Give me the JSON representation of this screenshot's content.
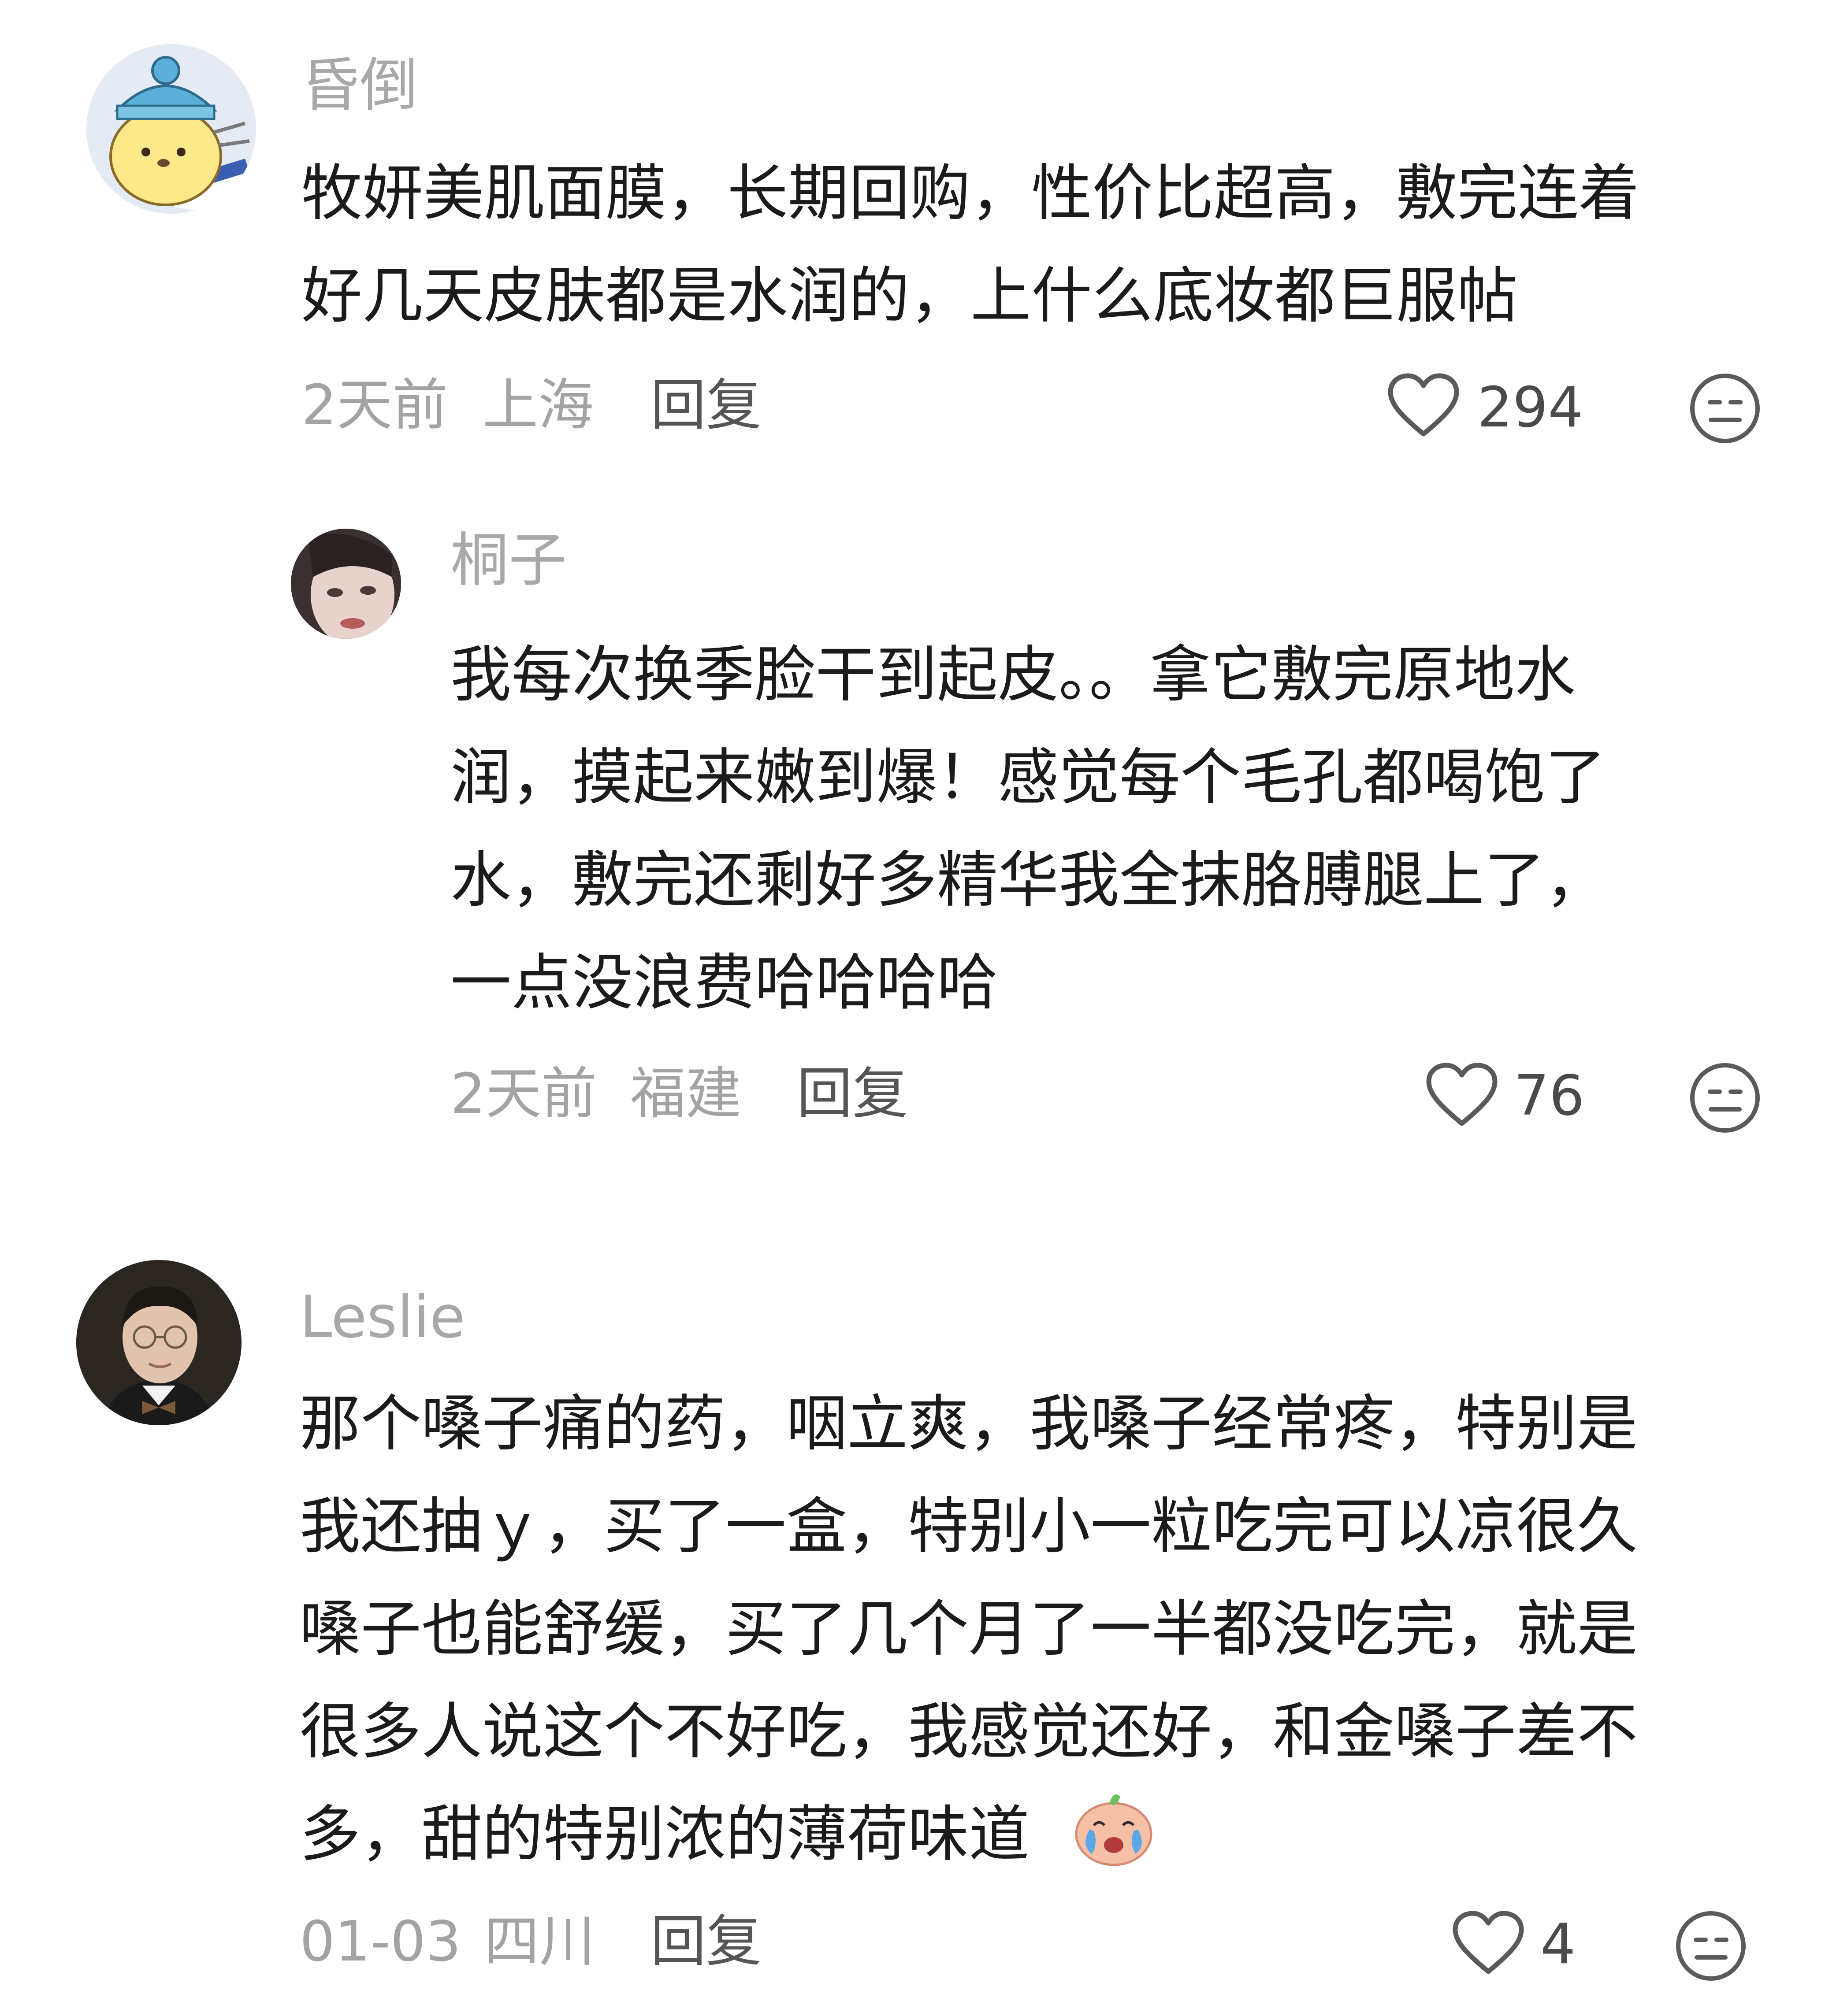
{
  "comments": [
    {
      "username": "昏倒",
      "avatar_icon": "pompompurin-hat-avatar",
      "lines": [
        "牧妍美肌面膜，长期回购，性价比超高，敷完连着",
        "好几天皮肤都是水润的，上什么底妆都巨服帖"
      ],
      "time": "2天前",
      "location": "上海",
      "reply_label": "回复",
      "likes": "294"
    },
    {
      "username": "桐子",
      "avatar_icon": "girl-face-avatar",
      "lines": [
        "我每次换季脸干到起皮。。拿它敷完原地水",
        "润，摸起来嫩到爆！感觉每个毛孔都喝饱了",
        "水，敷完还剩好多精华我全抹胳膊腿上了，",
        "一点没浪费哈哈哈哈"
      ],
      "time": "2天前",
      "location": "福建",
      "reply_label": "回复",
      "likes": "76"
    },
    {
      "username": "Leslie",
      "avatar_icon": "man-glasses-bowtie-avatar",
      "lines": [
        "那个嗓子痛的药，咽立爽，我嗓子经常疼，特别是",
        "我还抽ｙ，买了一盒，特别小一粒吃完可以凉很久",
        "嗓子也能舒缓，买了几个月了一半都没吃完，就是",
        "很多人说这个不好吃，我感觉还好，和金嗓子差不",
        "多，甜的特别浓的薄荷味道"
      ],
      "emoji": "crying-peach-emoji",
      "time": "01-03",
      "location": "四川",
      "reply_label": "回复",
      "likes": "4"
    }
  ],
  "colors": {
    "text": "#1b1b1b",
    "username": "#a8a8a8",
    "meta": "#a3a3a3",
    "icon": "#5a5a5a"
  }
}
